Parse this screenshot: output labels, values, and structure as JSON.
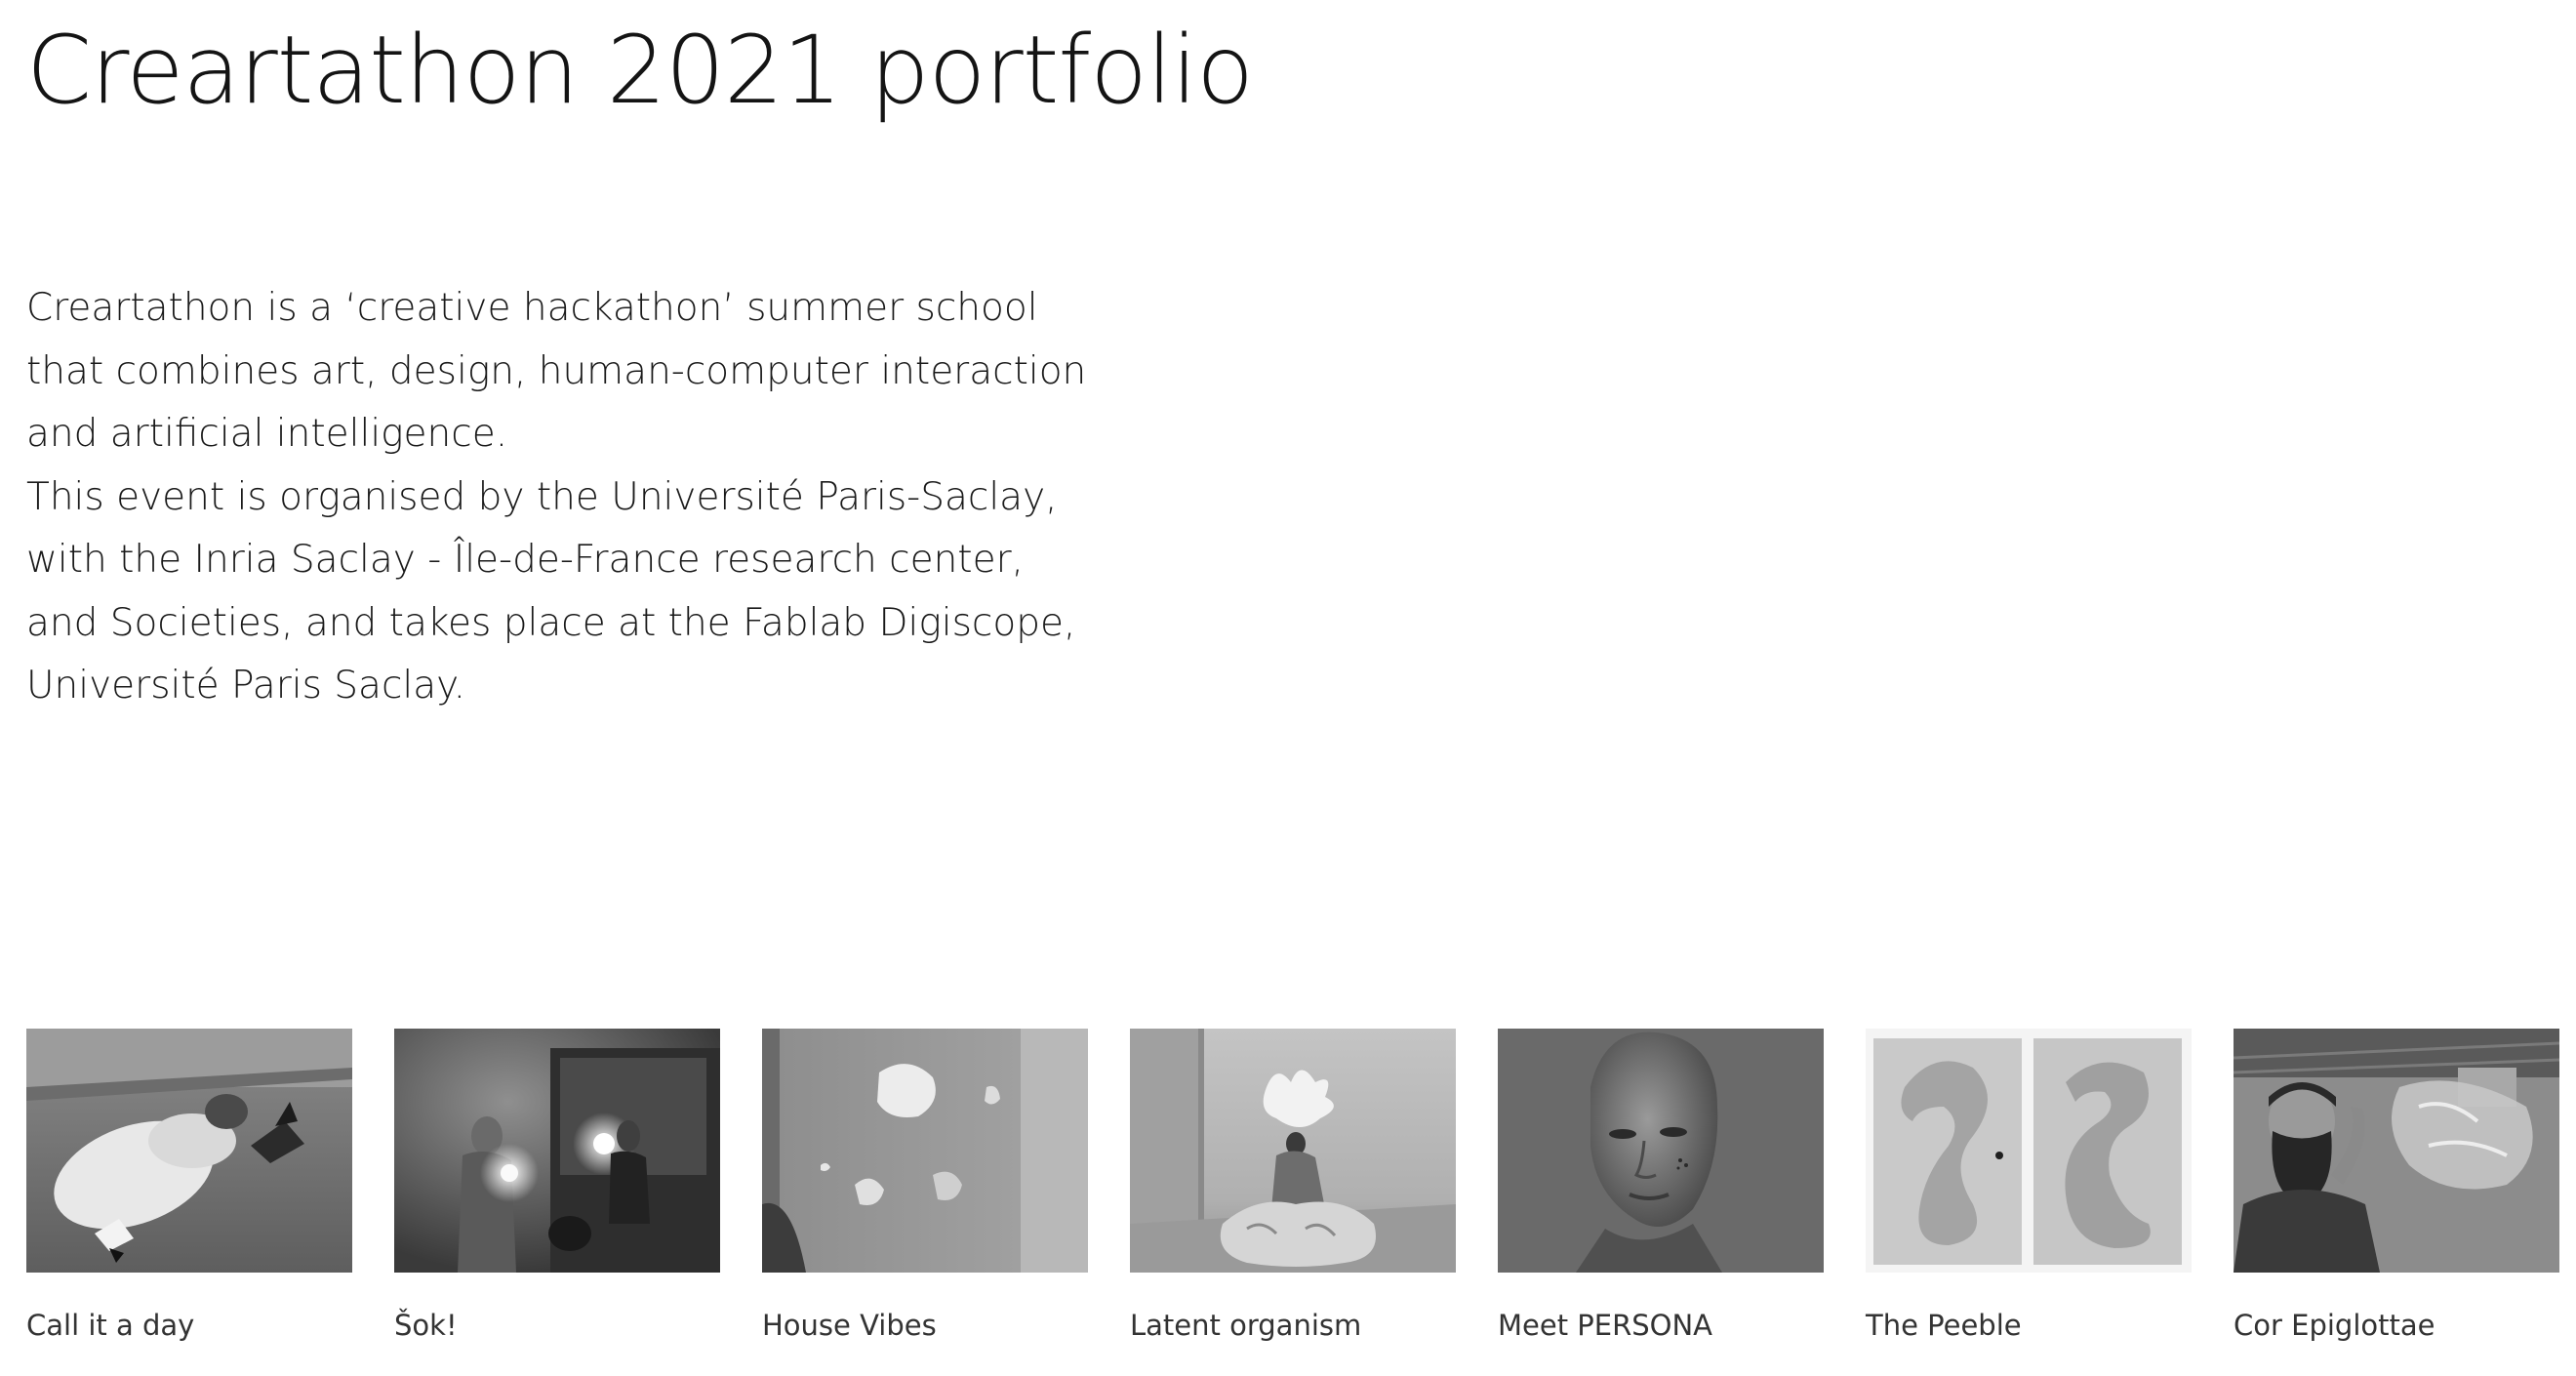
{
  "page": {
    "title": "Creartathon 2021 portfolio"
  },
  "intro": {
    "lines": [
      "Creartathon is a ‘creative hackathon’ summer school",
      "that combines art, design, human-computer interaction",
      "and artificial intelligence.",
      "This event is organised by the Université Paris-Saclay,",
      "with the Inria Saclay - Île-de-France research center,",
      "and Societies, and takes place at the Fablab Digiscope,",
      "Université Paris Saclay."
    ]
  },
  "projects": [
    {
      "title": "Call it a day",
      "image": "person-lying-on-pillow-photo"
    },
    {
      "title": "Šok!",
      "image": "people-with-glowing-light-photo"
    },
    {
      "title": "House Vibes",
      "image": "wall-mounted-organic-shapes-photo"
    },
    {
      "title": "Latent organism",
      "image": "person-with-floral-sculpture-photo"
    },
    {
      "title": "Meet PERSONA",
      "image": "digital-human-portrait-photo"
    },
    {
      "title": "The Peeble",
      "image": "molded-curved-forms-photo"
    },
    {
      "title": "Cor Epiglottae",
      "image": "bearded-man-with-sculpture-photo"
    }
  ]
}
